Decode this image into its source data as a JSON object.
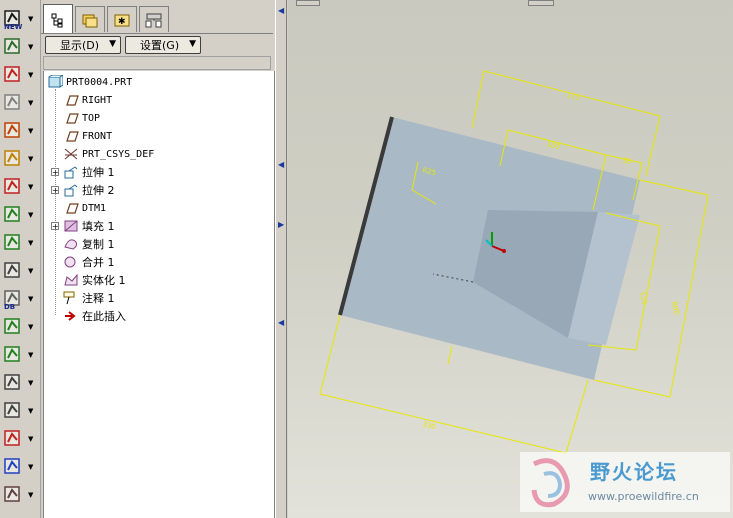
{
  "toolbar": {
    "tools": [
      {
        "icon": "new-feature-icon",
        "label": "NEW"
      },
      {
        "icon": "stack-icon"
      },
      {
        "icon": "magnet-icon"
      },
      {
        "icon": "pencil-angle-icon"
      },
      {
        "icon": "arrow-magnet-icon"
      },
      {
        "icon": "red-pencil-icon"
      },
      {
        "icon": "pen-icon"
      },
      {
        "icon": "cut-shape-icon"
      },
      {
        "icon": "pipe-icon"
      },
      {
        "icon": "grid-icon"
      },
      {
        "icon": "db-icon",
        "label": "DB"
      },
      {
        "icon": "green-triangle-icon"
      },
      {
        "icon": "green-slash-icon"
      },
      {
        "icon": "bars-icon"
      },
      {
        "icon": "ruler-icon"
      },
      {
        "icon": "multi-bar-icon"
      },
      {
        "icon": "chip-icon"
      },
      {
        "icon": "array-icon"
      }
    ]
  },
  "nav": {
    "tabs": [
      {
        "name": "tree-tab",
        "icon": "tree-icon"
      },
      {
        "name": "folder-tab",
        "icon": "folder-stack-icon"
      },
      {
        "name": "favorites-tab",
        "icon": "star-folder-icon"
      },
      {
        "name": "connections-tab",
        "icon": "network-icon"
      }
    ],
    "show_button": "显示(D)",
    "settings_button": "设置(G)"
  },
  "tree": {
    "root": "PRT0004.PRT",
    "items": [
      {
        "label": "RIGHT",
        "icon": "datum-plane-icon",
        "mono": true,
        "expandable": false
      },
      {
        "label": "TOP",
        "icon": "datum-plane-icon",
        "mono": true,
        "expandable": false
      },
      {
        "label": "FRONT",
        "icon": "datum-plane-icon",
        "mono": true,
        "expandable": false
      },
      {
        "label": "PRT_CSYS_DEF",
        "icon": "csys-icon",
        "mono": true,
        "expandable": false
      },
      {
        "label": "拉伸 1",
        "icon": "extrude-icon",
        "mono": false,
        "expandable": true
      },
      {
        "label": "拉伸 2",
        "icon": "extrude-icon",
        "mono": false,
        "expandable": true
      },
      {
        "label": "DTM1",
        "icon": "datum-plane-icon",
        "mono": true,
        "expandable": false
      },
      {
        "label": "填充 1",
        "icon": "fill-icon",
        "mono": false,
        "expandable": true
      },
      {
        "label": "复制 1",
        "icon": "copy-icon",
        "mono": false,
        "expandable": false
      },
      {
        "label": "合并 1",
        "icon": "merge-icon",
        "mono": false,
        "expandable": false
      },
      {
        "label": "实体化 1",
        "icon": "solidify-icon",
        "mono": false,
        "expandable": false
      },
      {
        "label": "注释 1",
        "icon": "note-icon",
        "mono": false,
        "expandable": false
      },
      {
        "label": "在此插入",
        "icon": "insert-arrow-icon",
        "mono": false,
        "expandable": false
      }
    ]
  },
  "viewport": {
    "dims": {
      "top_width": "173",
      "inner_width": "100",
      "offset": "30",
      "angle": "R25",
      "height_outer": "600",
      "height_inner": "125",
      "bottom_width": "330"
    }
  },
  "watermark": {
    "title": "野火论坛",
    "url": "www.proewildfire.cn"
  },
  "colors": {
    "dimension": "#e8e800",
    "part_face": "#a9b9c6",
    "part_face_dark": "#98a8b6",
    "selection_edge": "#3a3a3a"
  }
}
